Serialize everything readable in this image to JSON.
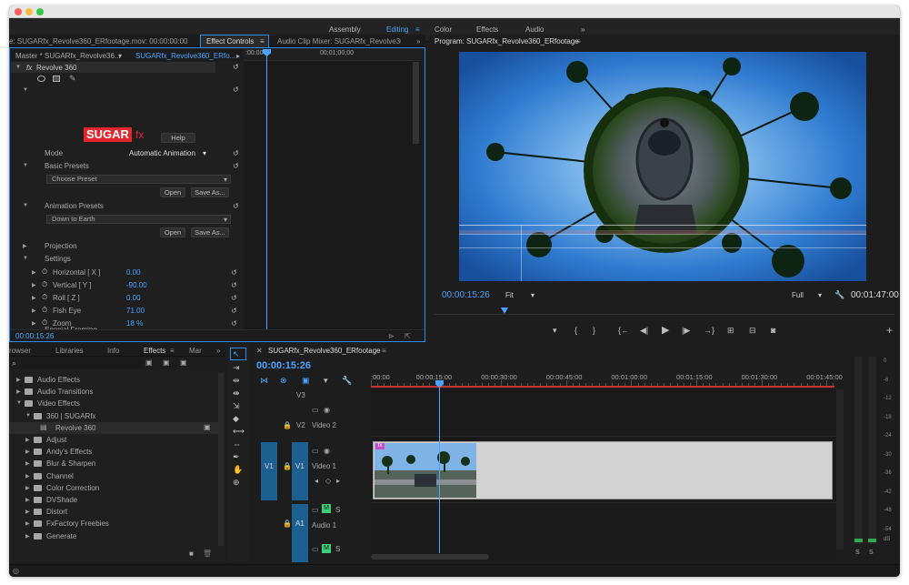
{
  "workspaces": {
    "items": [
      "Assembly",
      "Editing",
      "Color",
      "Effects",
      "Audio"
    ],
    "active": "Editing",
    "more": "»"
  },
  "source_panel": {
    "tabs": {
      "source": "e: SUGARfx_Revolve360_ERfootage.mov: 00:00:00:00",
      "effect_controls": "Effect Controls",
      "audio_mixer": "Audio Clip Mixer: SUGARfx_Revolve360_ERfootage"
    },
    "master": "Master * SUGARfx_Revolve36...",
    "clip": "SUGARfx_Revolve360_ERfo...",
    "ruler": {
      "start": ":00:00",
      "mid": "00;01;00;00"
    },
    "effect_name": "Revolve 360",
    "logo": {
      "main": "SUGAR",
      "suffix": "fx"
    },
    "help": "Help",
    "mode": {
      "label": "Mode",
      "value": "Automatic Animation"
    },
    "basic_presets": {
      "label": "Basic Presets",
      "select": "Choose Preset",
      "open": "Open",
      "save": "Save As..."
    },
    "animation_presets": {
      "label": "Animation Presets",
      "select": "Down to Earth",
      "open": "Open",
      "save": "Save As..."
    },
    "projection": "Projection",
    "settings": "Settings",
    "params": [
      {
        "label": "Horizontal [ X ]",
        "value": "0.00"
      },
      {
        "label": "Vertical [ Y ]",
        "value": "-90.00"
      },
      {
        "label": "Roll [ Z ]",
        "value": "0.00"
      },
      {
        "label": "Fish Eye",
        "value": "71.00"
      },
      {
        "label": "Zoom",
        "value": "18 %"
      }
    ],
    "special": "Special Framing",
    "timecode": "00:00:15:26"
  },
  "program": {
    "title": "Program: SUGARfx_Revolve360_ERfootage",
    "timecode": "00:00:15:26",
    "fit": "Fit",
    "full": "Full",
    "duration": "00:01:47:00"
  },
  "project": {
    "tabs": [
      "rowser",
      "Libraries",
      "Info",
      "Effects",
      "Mar"
    ],
    "active": "Effects",
    "tree": [
      {
        "label": "Audio Effects",
        "level": 0,
        "open": false,
        "folder": true
      },
      {
        "label": "Audio Transitions",
        "level": 0,
        "open": false,
        "folder": true
      },
      {
        "label": "Video Effects",
        "level": 0,
        "open": true,
        "folder": true
      },
      {
        "label": "360 | SUGARfx",
        "level": 1,
        "open": true,
        "folder": true
      },
      {
        "label": "Revolve 360",
        "level": 2,
        "open": false,
        "folder": false
      },
      {
        "label": "Adjust",
        "level": 1,
        "open": false,
        "folder": true
      },
      {
        "label": "Andy's Effects",
        "level": 1,
        "open": false,
        "folder": true
      },
      {
        "label": "Blur & Sharpen",
        "level": 1,
        "open": false,
        "folder": true
      },
      {
        "label": "Channel",
        "level": 1,
        "open": false,
        "folder": true
      },
      {
        "label": "Color Correction",
        "level": 1,
        "open": false,
        "folder": true
      },
      {
        "label": "DVShade",
        "level": 1,
        "open": false,
        "folder": true
      },
      {
        "label": "Distort",
        "level": 1,
        "open": false,
        "folder": true
      },
      {
        "label": "FxFactory Freebies",
        "level": 1,
        "open": false,
        "folder": true
      },
      {
        "label": "Generate",
        "level": 1,
        "open": false,
        "folder": true
      }
    ]
  },
  "timeline": {
    "title": "SUGARfx_Revolve360_ERfootage",
    "timecode": "00:00:15:26",
    "ruler": [
      ":00:00",
      "00:00:15:00",
      "00:00:30:00",
      "00:00:45:00",
      "00:01:00:00",
      "00:01:15:00",
      "00:01:30:00",
      "00:01:45:00"
    ],
    "tracks": {
      "v3": "V3",
      "v2": "V2",
      "v2name": "Video 2",
      "v1src": "V1",
      "v1": "V1",
      "v1name": "Video 1",
      "a1": "A1",
      "a1name": "Audio 1",
      "m": "M",
      "s": "S"
    },
    "clip_badge": "fx"
  },
  "meter": {
    "scale": [
      "0",
      "-6",
      "-12",
      "-18",
      "-24",
      "-30",
      "-36",
      "-42",
      "-48",
      "-54"
    ],
    "db": "dB",
    "solo": "S"
  },
  "colors": {
    "accent": "#2d8ceb",
    "playhead": "#4aa3ff",
    "logo_red": "#e1262d",
    "clip": "#d2d2d2",
    "inout": "#c8332b"
  }
}
